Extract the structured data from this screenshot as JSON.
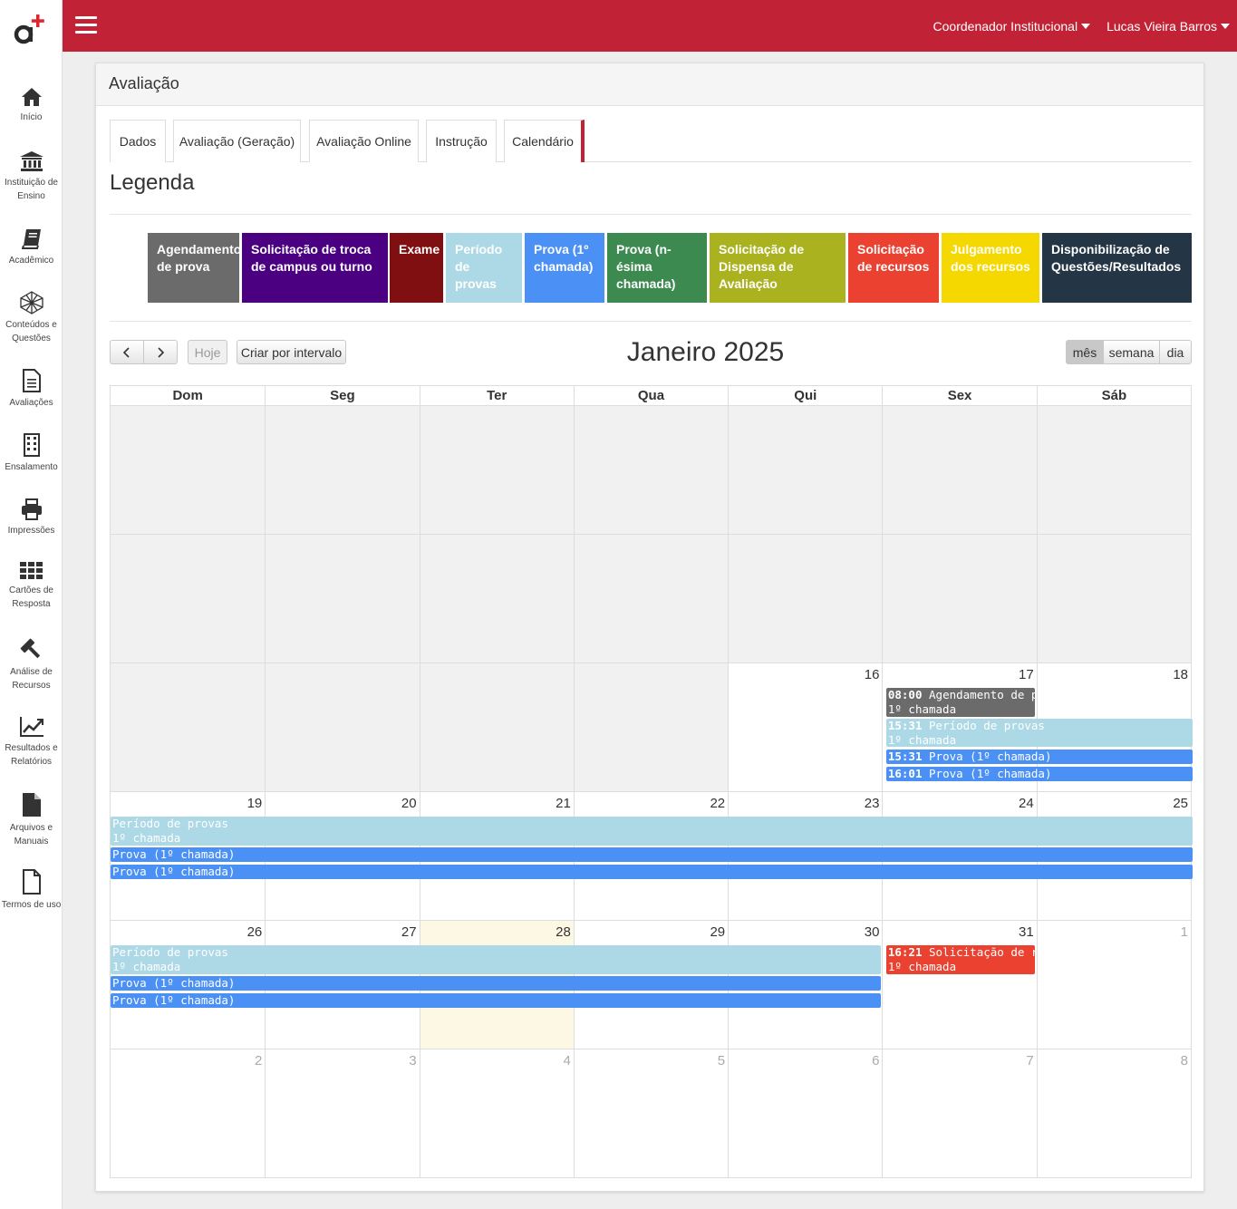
{
  "sidebar": {
    "items": [
      {
        "label": "Início",
        "icon": "home-icon"
      },
      {
        "label": "Instituição de Ensino",
        "icon": "institution-icon"
      },
      {
        "label": "Acadêmico",
        "icon": "book-icon"
      },
      {
        "label": "Conteúdos e Questões",
        "icon": "polyhedron-icon"
      },
      {
        "label": "Avaliações",
        "icon": "document-icon"
      },
      {
        "label": "Ensalamento",
        "icon": "building-icon"
      },
      {
        "label": "Impressões",
        "icon": "printer-icon"
      },
      {
        "label": "Cartões de Resposta",
        "icon": "grid-icon"
      },
      {
        "label": "Análise de Recursos",
        "icon": "gavel-icon"
      },
      {
        "label": "Resultados e Relatórios",
        "icon": "chart-line-icon"
      },
      {
        "label": "Arquivos e Manuais",
        "icon": "file-icon"
      },
      {
        "label": "Termos de uso",
        "icon": "file-outline-icon"
      }
    ]
  },
  "topbar": {
    "role": "Coordenador Institucional",
    "user": "Lucas Vieira Barros",
    "colors": {
      "brand": "#c12235"
    }
  },
  "panel": {
    "title": "Avaliação",
    "tabs": [
      "Dados",
      "Avaliação (Geração)",
      "Avaliação Online",
      "Instrução",
      "Calendário"
    ],
    "active_tab": "Calendário"
  },
  "legend": {
    "title": "Legenda",
    "items": [
      {
        "label": "Agendamento de prova",
        "color": "#6b6b6b",
        "text_color": "#ffffff"
      },
      {
        "label": "Solicitação de troca de campus ou turno",
        "color": "#4b0082",
        "text_color": "#ffffff"
      },
      {
        "label": "Exame",
        "color": "#800f12",
        "text_color": "#ffffff"
      },
      {
        "label": "Período de provas",
        "color": "#add8e6",
        "text_color": "#ffffff"
      },
      {
        "label": "Prova (1º chamada)",
        "color": "#4a90f5",
        "text_color": "#ffffff"
      },
      {
        "label": "Prova (n-ésima chamada)",
        "color": "#3c8a50",
        "text_color": "#ffffff"
      },
      {
        "label": "Solicitação de Dispensa de Avaliação",
        "color": "#aab220",
        "text_color": "#ffffff"
      },
      {
        "label": "Solicitação de recursos",
        "color": "#ea4130",
        "text_color": "#ffffff"
      },
      {
        "label": "Julgamento dos recursos",
        "color": "#f5d800",
        "text_color": "#ffffff"
      },
      {
        "label": "Disponibilização de Questões/Resultados",
        "color": "#243546",
        "text_color": "#ffffff"
      }
    ]
  },
  "calendar": {
    "title": "Janeiro 2025",
    "buttons": {
      "prev": "‹",
      "next": "›",
      "today": "Hoje",
      "create_range": "Criar por intervalo"
    },
    "views": [
      "mês",
      "semana",
      "dia"
    ],
    "active_view": "mês",
    "weekdays": [
      "Dom",
      "Seg",
      "Ter",
      "Qua",
      "Qui",
      "Sex",
      "Sáb"
    ],
    "weeks": [
      [
        "",
        "",
        "",
        "",
        "",
        "",
        ""
      ],
      [
        "",
        "",
        "",
        "",
        "",
        "",
        ""
      ],
      [
        "",
        "",
        "",
        "",
        "16",
        "17",
        "18"
      ],
      [
        "19",
        "20",
        "21",
        "22",
        "23",
        "24",
        "25"
      ],
      [
        "26",
        "27",
        "28",
        "29",
        "30",
        "31",
        "1"
      ],
      [
        "2",
        "3",
        "4",
        "5",
        "6",
        "7",
        "8"
      ]
    ],
    "today": "28",
    "events": [
      {
        "time": "08:00",
        "title": "Agendamento de pr",
        "subtitle": "1º chamada",
        "type": "Agendamento de prova"
      },
      {
        "time": "15:31",
        "title": "Período de provas",
        "subtitle": "1º chamada",
        "type": "Período de provas"
      },
      {
        "time": "15:31",
        "title": "Prova (1º chamada)",
        "type": "Prova (1º chamada)"
      },
      {
        "time": "16:01",
        "title": "Prova (1º chamada)",
        "type": "Prova (1º chamada)"
      },
      {
        "title": "Período de provas",
        "subtitle": "1º chamada",
        "type": "Período de provas"
      },
      {
        "title": "Prova (1º chamada)",
        "type": "Prova (1º chamada)"
      },
      {
        "title": "Prova (1º chamada)",
        "type": "Prova (1º chamada)"
      },
      {
        "title": "Período de provas",
        "subtitle": "1º chamada",
        "type": "Período de provas"
      },
      {
        "title": "Prova (1º chamada)",
        "type": "Prova (1º chamada)"
      },
      {
        "title": "Prova (1º chamada)",
        "type": "Prova (1º chamada)"
      },
      {
        "time": "16:21",
        "title": "Solicitação de recur",
        "subtitle": "1º chamada",
        "type": "Solicitação de recursos"
      }
    ]
  }
}
